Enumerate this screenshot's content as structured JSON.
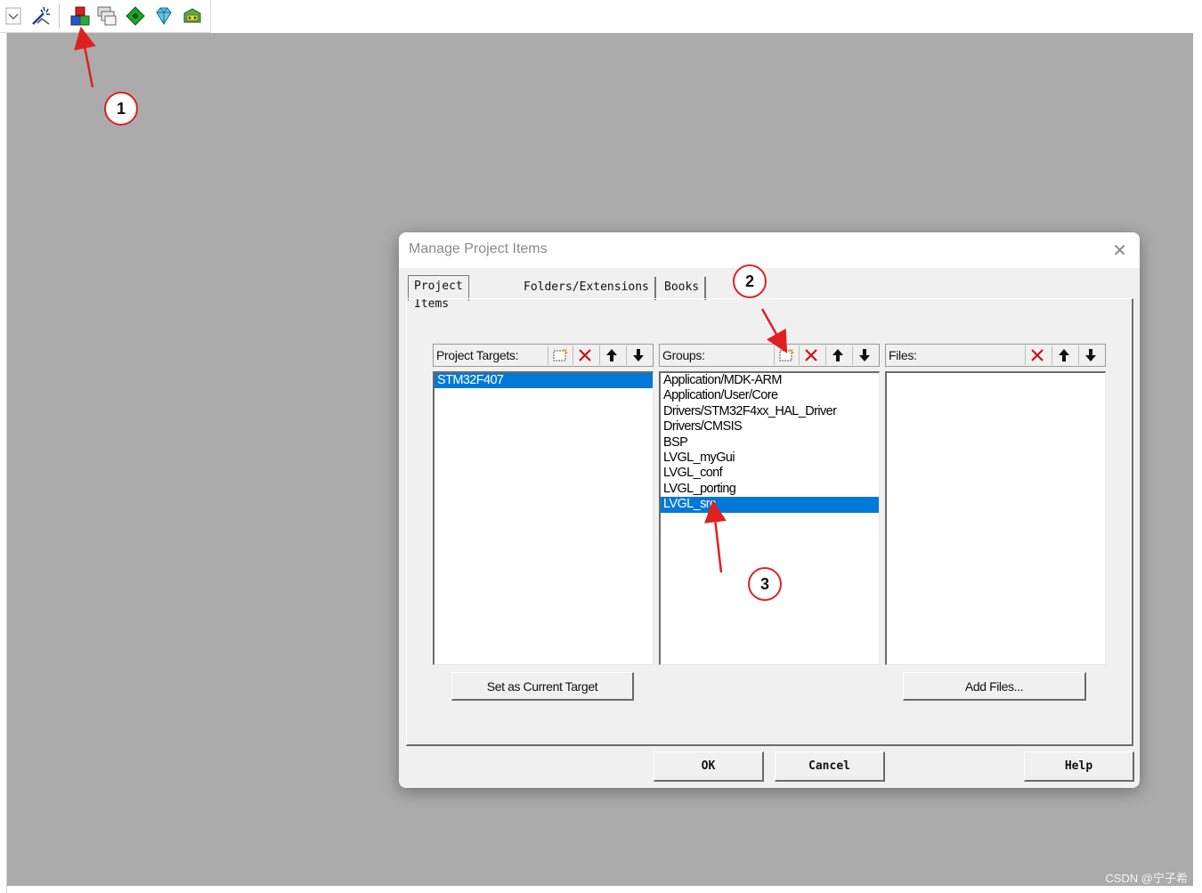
{
  "dialog": {
    "title": "Manage Project Items",
    "tabs": [
      {
        "label": "Project Items",
        "active": true
      },
      {
        "label": "Folders/Extensions",
        "active": false
      },
      {
        "label": "Books",
        "active": false
      }
    ],
    "targets": {
      "label": "Project Targets:",
      "items": [
        "STM32F407"
      ],
      "selected_index": 0
    },
    "groups": {
      "label": "Groups:",
      "items": [
        "Application/MDK-ARM",
        "Application/User/Core",
        "Drivers/STM32F4xx_HAL_Driver",
        "Drivers/CMSIS",
        "BSP",
        "LVGL_myGui",
        "LVGL_conf",
        "LVGL_porting",
        "LVGL_src"
      ],
      "selected_index": 8
    },
    "files": {
      "label": "Files:",
      "items": []
    },
    "buttons": {
      "set_target": "Set as Current Target",
      "add_files": "Add Files...",
      "ok": "OK",
      "cancel": "Cancel",
      "help": "Help"
    }
  },
  "annotations": {
    "callout_1": "1",
    "callout_2": "2",
    "callout_3": "3",
    "color": "#e02020"
  },
  "watermark": "CSDN @宁子希",
  "colors": {
    "selection": "#0078d7",
    "workspace": "#ababab",
    "dialog_bg": "#f0f0f0"
  },
  "toolbar_icons": [
    "dropdown-icon",
    "wand-icon",
    "manage-project-items-icon",
    "stacked-windows-icon",
    "green-diamond-icon",
    "gem-icon",
    "package-icon"
  ]
}
